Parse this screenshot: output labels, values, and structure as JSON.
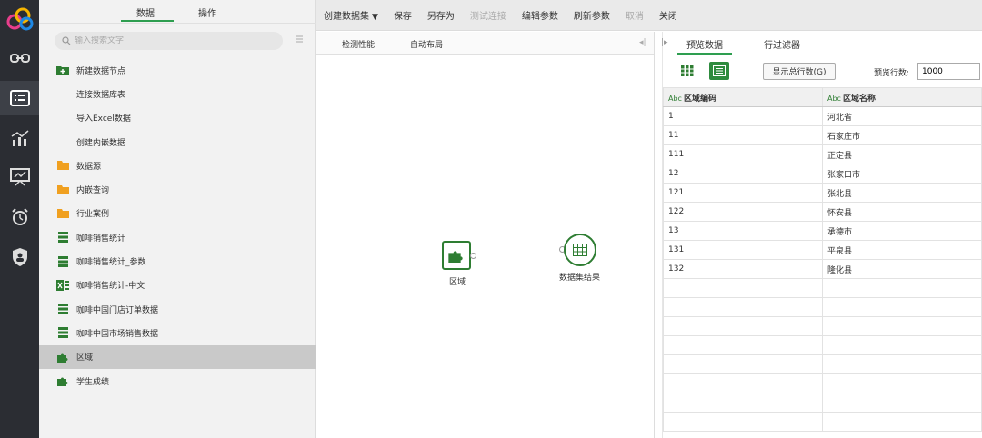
{
  "panel_tabs": {
    "data": "数据",
    "operate": "操作"
  },
  "search": {
    "placeholder": "输入搜索文字"
  },
  "tree": [
    {
      "label": "新建数据节点",
      "icon": "new-node-icon",
      "kind": "root"
    },
    {
      "label": "连接数据库表",
      "kind": "sub"
    },
    {
      "label": "导入Excel数据",
      "kind": "sub"
    },
    {
      "label": "创建内嵌数据",
      "kind": "sub"
    },
    {
      "label": "数据源",
      "icon": "folder-icon",
      "kind": "folder"
    },
    {
      "label": "内嵌查询",
      "icon": "folder-icon",
      "kind": "folder"
    },
    {
      "label": "行业案例",
      "icon": "folder-icon",
      "kind": "folder"
    },
    {
      "label": "咖啡销售统计",
      "icon": "dataset-icon",
      "kind": "dataset"
    },
    {
      "label": "咖啡销售统计_参数",
      "icon": "dataset-icon",
      "kind": "dataset"
    },
    {
      "label": "咖啡销售统计-中文",
      "icon": "excel-icon",
      "kind": "excel"
    },
    {
      "label": "咖啡中国门店订单数据",
      "icon": "dataset-icon",
      "kind": "dataset"
    },
    {
      "label": "咖啡中国市场销售数据",
      "icon": "dataset-icon",
      "kind": "dataset"
    },
    {
      "label": "区域",
      "icon": "puzzle-icon",
      "kind": "puzzle",
      "selected": true
    },
    {
      "label": "学生成绩",
      "icon": "puzzle-icon",
      "kind": "puzzle"
    }
  ],
  "toolbar": {
    "create_dataset": "创建数据集",
    "caret": "▼",
    "save": "保存",
    "save_as": "另存为",
    "test_connection": "测试连接",
    "edit_params": "编辑参数",
    "refresh_params": "刷新参数",
    "cancel": "取消",
    "close": "关闭"
  },
  "canvas": {
    "check_perf": "检测性能",
    "auto_layout": "自动布局",
    "node1_label": "区域",
    "node2_label": "数据集结果"
  },
  "preview": {
    "tab_preview": "预览数据",
    "tab_filter": "行过滤器",
    "show_total": "显示总行数(G)",
    "rows_label": "预览行数:",
    "rows_value": "1000",
    "col_type_badge": "Abc",
    "columns": [
      "区域编码",
      "区域名称"
    ],
    "rows": [
      [
        "1",
        "河北省"
      ],
      [
        "11",
        "石家庄市"
      ],
      [
        "111",
        "正定县"
      ],
      [
        "12",
        "张家口市"
      ],
      [
        "121",
        "张北县"
      ],
      [
        "122",
        "怀安县"
      ],
      [
        "13",
        "承德市"
      ],
      [
        "131",
        "平泉县"
      ],
      [
        "132",
        "隆化县"
      ]
    ],
    "empty_rows": 8
  },
  "colors": {
    "accent": "#2e9e50",
    "node_green": "#2e7d32",
    "rail": "#2b2d33",
    "folder": "#f0a020"
  }
}
